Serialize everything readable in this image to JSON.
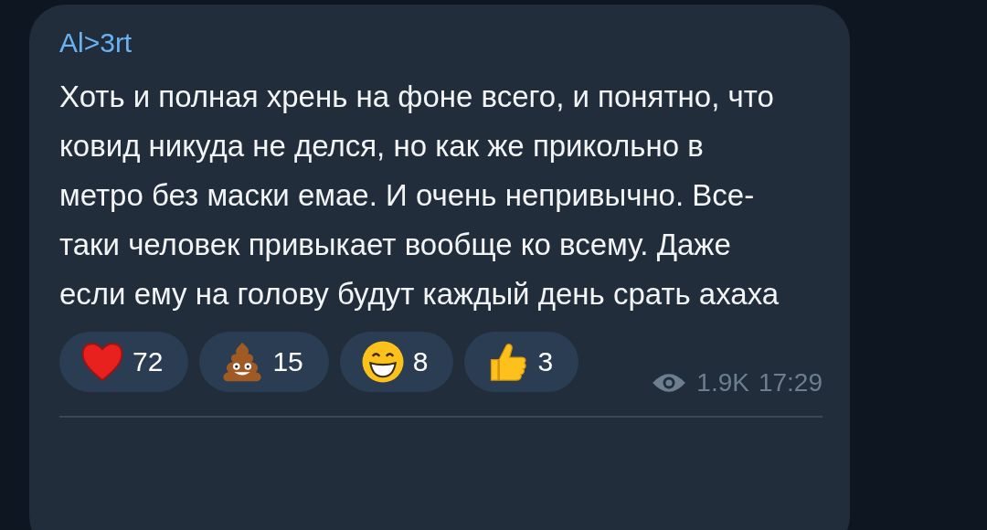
{
  "message": {
    "author": "Al>3rt",
    "text": "Хоть и полная хрень на фоне всего, и понятно, что ковид никуда не делся, но как же прикольно в метро без маски емае. И очень непривычно. Все-таки человек привыкает вообще ко всему. Даже если ему на голову будут каждый день срать ахаха",
    "reactions": [
      {
        "kind": "heart",
        "count": "72"
      },
      {
        "kind": "poop",
        "count": "15"
      },
      {
        "kind": "grin",
        "count": "8"
      },
      {
        "kind": "thumbs-up",
        "count": "3"
      }
    ],
    "views": "1.9K",
    "time": "17:29"
  }
}
